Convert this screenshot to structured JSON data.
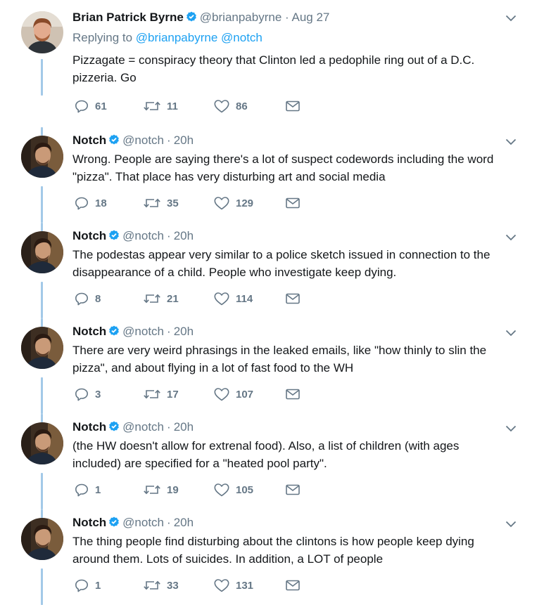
{
  "first_tweet": {
    "name": "Brian Patrick Byrne",
    "handle": "@brianpabyrne",
    "separator": "·",
    "time": "Aug 27",
    "reply_prefix": "Replying to",
    "reply_users": [
      "@brianpabyrne",
      "@notch"
    ],
    "text": "Pizzagate = conspiracy theory that Clinton led a pedophile ring out of a D.C. pizzeria. Go",
    "replies": "61",
    "retweets": "11",
    "likes": "86"
  },
  "tweets": [
    {
      "name": "Notch",
      "handle": "@notch",
      "separator": "·",
      "time": "20h",
      "text": "Wrong. People are saying there's a lot of suspect codewords including the word \"pizza\". That place has very disturbing art and social media",
      "replies": "18",
      "retweets": "35",
      "likes": "129"
    },
    {
      "name": "Notch",
      "handle": "@notch",
      "separator": "·",
      "time": "20h",
      "text": "The podestas appear very similar to a police sketch issued in connection to the disappearance of a child. People who investigate keep dying.",
      "replies": "8",
      "retweets": "21",
      "likes": "114"
    },
    {
      "name": "Notch",
      "handle": "@notch",
      "separator": "·",
      "time": "20h",
      "text": "There are very weird phrasings in the leaked emails, like \"how thinly to slin the pizza\", and about flying in a lot of fast food to the WH",
      "replies": "3",
      "retweets": "17",
      "likes": "107"
    },
    {
      "name": "Notch",
      "handle": "@notch",
      "separator": "·",
      "time": "20h",
      "text": "(the HW doesn't allow for extrenal food). Also, a list of children (with ages included) are specified for a \"heated pool party\".",
      "replies": "1",
      "retweets": "19",
      "likes": "105"
    },
    {
      "name": "Notch",
      "handle": "@notch",
      "separator": "·",
      "time": "20h",
      "text": "The thing people find disturbing about the clintons is how people keep dying around them. Lots of suicides. In addition, a LOT of people",
      "replies": "1",
      "retweets": "33",
      "likes": "131"
    }
  ],
  "colors": {
    "accent": "#1da1f2",
    "thread_line": "#a3c9e8",
    "secondary_text": "#657786",
    "primary_text": "#14171a"
  },
  "icons": {
    "verified": "verified-badge-icon",
    "caret": "chevron-down-icon",
    "reply": "reply-icon",
    "retweet": "retweet-icon",
    "like": "heart-icon",
    "message": "envelope-icon"
  }
}
